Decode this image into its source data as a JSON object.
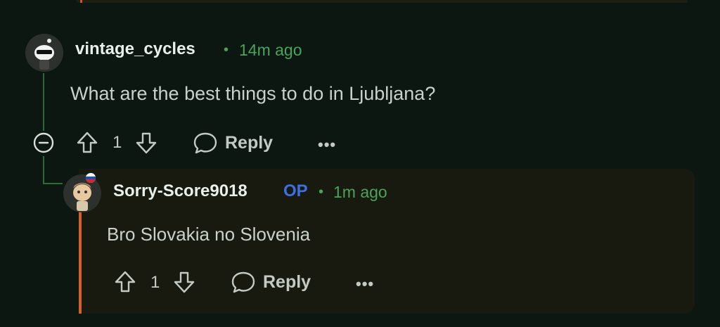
{
  "comment": {
    "username": "vintage_cycles",
    "separator": "•",
    "time": "14m ago",
    "body": "What are the best things to do in Ljubljana?",
    "votes": "1",
    "reply_label": "Reply",
    "more_label": "•••"
  },
  "reply": {
    "username": "Sorry-Score9018",
    "op_badge": "OP",
    "separator": "•",
    "time": "1m ago",
    "body": "Bro Slovakia no Slovenia",
    "votes": "1",
    "reply_label": "Reply",
    "more_label": "•••"
  },
  "colors": {
    "background": "#0b1710",
    "thread_line": "#2c6b34",
    "timestamp": "#49a45a",
    "op_badge": "#3d6fe0",
    "reply_accent": "#d2602c"
  }
}
